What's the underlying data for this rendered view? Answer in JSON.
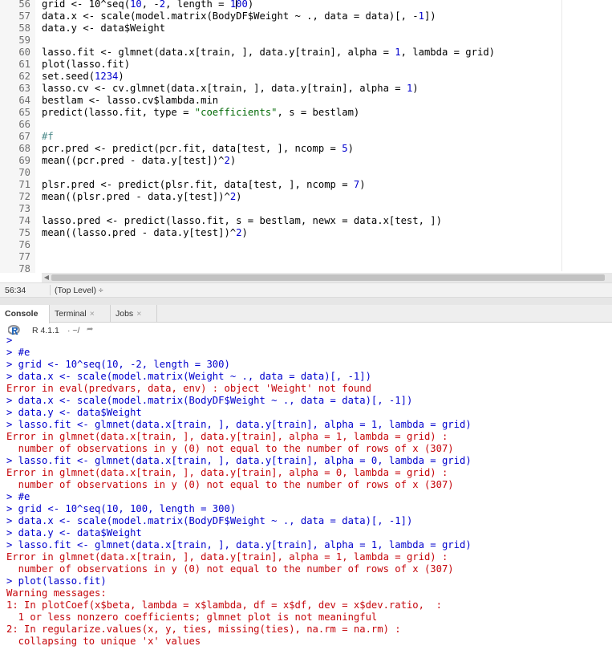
{
  "editor": {
    "lines": [
      {
        "n": "56",
        "html": "grid <- 10^seq(<span class=\"n\">10</span>, -<span class=\"n\">2</span>, length = <span class=\"n\">1</span><span class=\"cursor\"></span><span class=\"n\">00</span>)"
      },
      {
        "n": "57",
        "html": "data.x <- scale(model.matrix(BodyDF$Weight ~ ., data = data)[, -<span class=\"n\">1</span>])"
      },
      {
        "n": "58",
        "html": "data.y <- data$Weight"
      },
      {
        "n": "59",
        "html": ""
      },
      {
        "n": "60",
        "html": "lasso.fit <- glmnet(data.x[train, ], data.y[train], alpha = <span class=\"n\">1</span>, lambda = grid)"
      },
      {
        "n": "61",
        "html": "plot(lasso.fit)"
      },
      {
        "n": "62",
        "html": "set.seed(<span class=\"n\">1234</span>)"
      },
      {
        "n": "63",
        "html": "lasso.cv <- cv.glmnet(data.x[train, ], data.y[train], alpha = <span class=\"n\">1</span>)"
      },
      {
        "n": "64",
        "html": "bestlam <- lasso.cv$lambda.min"
      },
      {
        "n": "65",
        "html": "predict(lasso.fit, type = <span class=\"s\">\"coefficients\"</span>, s = bestlam)"
      },
      {
        "n": "66",
        "html": ""
      },
      {
        "n": "67",
        "html": "<span class=\"c\">#f</span>"
      },
      {
        "n": "68",
        "html": "pcr.pred <- predict(pcr.fit, data[test, ], ncomp = <span class=\"n\">5</span>)"
      },
      {
        "n": "69",
        "html": "mean((pcr.pred - data.y[test])^<span class=\"n\">2</span>)"
      },
      {
        "n": "70",
        "html": ""
      },
      {
        "n": "71",
        "html": "plsr.pred <- predict(plsr.fit, data[test, ], ncomp = <span class=\"n\">7</span>)"
      },
      {
        "n": "72",
        "html": "mean((plsr.pred - data.y[test])^<span class=\"n\">2</span>)"
      },
      {
        "n": "73",
        "html": ""
      },
      {
        "n": "74",
        "html": "lasso.pred <- predict(lasso.fit, s = bestlam, newx = data.x[test, ])"
      },
      {
        "n": "75",
        "html": "mean((lasso.pred - data.y[test])^<span class=\"n\">2</span>)"
      },
      {
        "n": "76",
        "html": ""
      },
      {
        "n": "77",
        "html": ""
      },
      {
        "n": "78",
        "html": ""
      }
    ]
  },
  "statusbar": {
    "position": "56:34",
    "scope": "(Top Level) ÷"
  },
  "tabs": {
    "console": "Console",
    "terminal": "Terminal",
    "jobs": "Jobs",
    "close_glyph": "×"
  },
  "r_info": {
    "version": "R 4.1.1",
    "path": "· ~/"
  },
  "console_lines": [
    {
      "t": "in",
      "text": ">"
    },
    {
      "t": "in",
      "text": "> #e"
    },
    {
      "t": "in",
      "text": "> grid <- 10^seq(10, -2, length = 300)"
    },
    {
      "t": "in",
      "text": "> data.x <- scale(model.matrix(Weight ~ ., data = data)[, -1])"
    },
    {
      "t": "err",
      "text": "Error in eval(predvars, data, env) : object 'Weight' not found"
    },
    {
      "t": "in",
      "text": "> data.x <- scale(model.matrix(BodyDF$Weight ~ ., data = data)[, -1])"
    },
    {
      "t": "in",
      "text": "> data.y <- data$Weight"
    },
    {
      "t": "in",
      "text": "> lasso.fit <- glmnet(data.x[train, ], data.y[train], alpha = 1, lambda = grid)"
    },
    {
      "t": "err",
      "text": "Error in glmnet(data.x[train, ], data.y[train], alpha = 1, lambda = grid) :"
    },
    {
      "t": "err",
      "text": "  number of observations in y (0) not equal to the number of rows of x (307)"
    },
    {
      "t": "in",
      "text": "> lasso.fit <- glmnet(data.x[train, ], data.y[train], alpha = 0, lambda = grid)"
    },
    {
      "t": "err",
      "text": "Error in glmnet(data.x[train, ], data.y[train], alpha = 0, lambda = grid) :"
    },
    {
      "t": "err",
      "text": "  number of observations in y (0) not equal to the number of rows of x (307)"
    },
    {
      "t": "in",
      "text": "> #e"
    },
    {
      "t": "in",
      "text": "> grid <- 10^seq(10, 100, length = 300)"
    },
    {
      "t": "in",
      "text": "> data.x <- scale(model.matrix(BodyDF$Weight ~ ., data = data)[, -1])"
    },
    {
      "t": "in",
      "text": "> data.y <- data$Weight"
    },
    {
      "t": "in",
      "text": "> lasso.fit <- glmnet(data.x[train, ], data.y[train], alpha = 1, lambda = grid)"
    },
    {
      "t": "err",
      "text": "Error in glmnet(data.x[train, ], data.y[train], alpha = 1, lambda = grid) :"
    },
    {
      "t": "err",
      "text": "  number of observations in y (0) not equal to the number of rows of x (307)"
    },
    {
      "t": "in",
      "text": "> plot(lasso.fit)"
    },
    {
      "t": "err",
      "text": "Warning messages:"
    },
    {
      "t": "err",
      "text": "1: In plotCoef(x$beta, lambda = x$lambda, df = x$df, dev = x$dev.ratio,  :"
    },
    {
      "t": "err",
      "text": "  1 or less nonzero coefficients; glmnet plot is not meaningful"
    },
    {
      "t": "err",
      "text": "2: In regularize.values(x, y, ties, missing(ties), na.rm = na.rm) :"
    },
    {
      "t": "err",
      "text": "  collapsing to unique 'x' values"
    }
  ],
  "icons": {
    "r_logo": "r-logo-icon",
    "dir_arrow": "arrow-right-icon",
    "scroll_left": "scroll-left-icon"
  },
  "colors": {
    "input": "#0000cd",
    "error": "#c5060b",
    "string": "#036a07",
    "comment": "#4d8a8a"
  }
}
